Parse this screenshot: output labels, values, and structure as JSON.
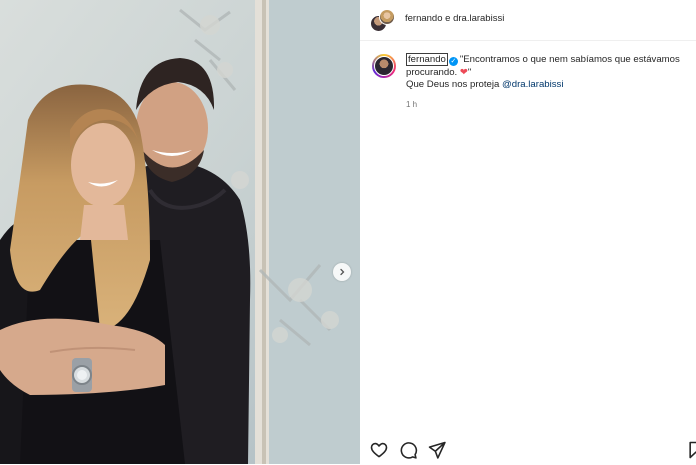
{
  "post": {
    "header": {
      "author1": "fernando",
      "conj": "e",
      "author2": "dra.larabissi"
    },
    "caption": {
      "username": "fernando",
      "quote_open": "\"Encontramos o que nem sabíamos que estávamos procurando.",
      "heart": "❤",
      "quote_close": "\"",
      "line2": "Que Deus nos proteja",
      "mention": "@dra.larabissi"
    },
    "time": "1 h"
  },
  "icons": {
    "next": "chevron-right-icon",
    "like": "heart-icon",
    "comment": "comment-icon",
    "share": "send-icon",
    "save": "bookmark-icon",
    "verified": "verified-badge-icon"
  },
  "colors": {
    "link": "#00376b",
    "verified": "#0095f6",
    "heart": "#ed4956",
    "meta": "#737373"
  }
}
